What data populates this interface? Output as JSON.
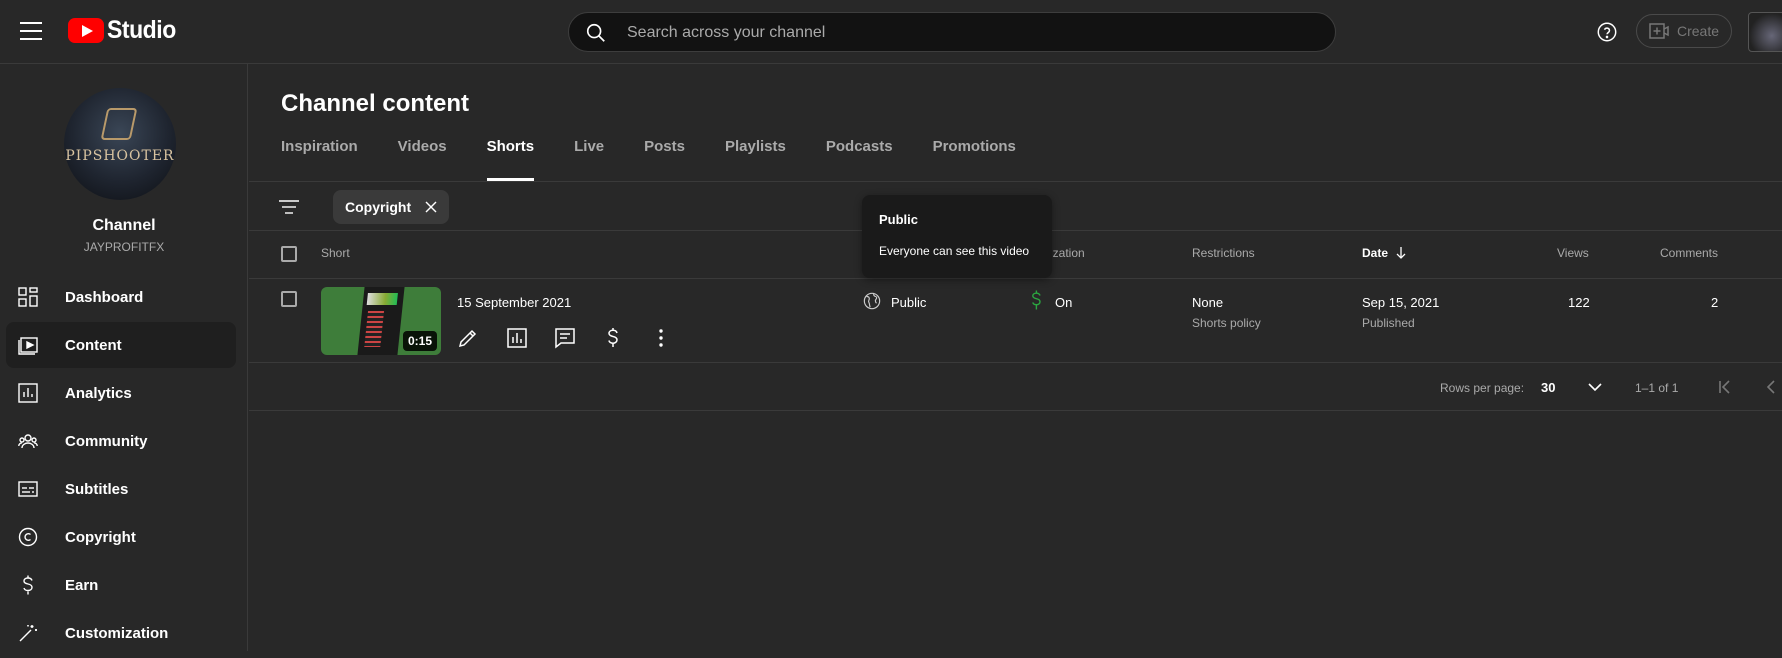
{
  "app": {
    "brand": "Studio"
  },
  "search": {
    "placeholder": "Search across your channel"
  },
  "header": {
    "create_label": "Create"
  },
  "channel": {
    "label": "Channel",
    "handle": "JAYPROFITFX",
    "avatar_text": "PIPSHOOTER"
  },
  "sidebar": {
    "items": [
      {
        "label": "Dashboard",
        "icon": "dashboard-icon"
      },
      {
        "label": "Content",
        "icon": "content-icon",
        "active": true
      },
      {
        "label": "Analytics",
        "icon": "analytics-icon"
      },
      {
        "label": "Community",
        "icon": "community-icon"
      },
      {
        "label": "Subtitles",
        "icon": "subtitles-icon"
      },
      {
        "label": "Copyright",
        "icon": "copyright-icon"
      },
      {
        "label": "Earn",
        "icon": "earn-icon"
      },
      {
        "label": "Customization",
        "icon": "customization-icon"
      }
    ]
  },
  "main": {
    "title": "Channel content",
    "tabs": [
      "Inspiration",
      "Videos",
      "Shorts",
      "Live",
      "Posts",
      "Playlists",
      "Podcasts",
      "Promotions"
    ],
    "active_tab": "Shorts",
    "filter_chip": "Copyright"
  },
  "table": {
    "headers": {
      "short": "Short",
      "monetization": "etization",
      "restrictions": "Restrictions",
      "date": "Date",
      "views": "Views",
      "comments": "Comments"
    },
    "rows": [
      {
        "duration": "0:15",
        "title": "15 September 2021",
        "visibility": "Public",
        "monetization": "On",
        "restrictions": "None",
        "restrictions_sub": "Shorts policy",
        "date": "Sep 15, 2021",
        "date_sub": "Published",
        "views": "122",
        "comments": "2"
      }
    ]
  },
  "tooltip": {
    "title": "Public",
    "text": "Everyone can see this video"
  },
  "pagination": {
    "rows_label": "Rows per page:",
    "rows_value": "30",
    "range": "1–1 of 1"
  },
  "colors": {
    "accent_red": "#ff0000",
    "monetization_green": "#2ba640",
    "background": "#282828"
  }
}
